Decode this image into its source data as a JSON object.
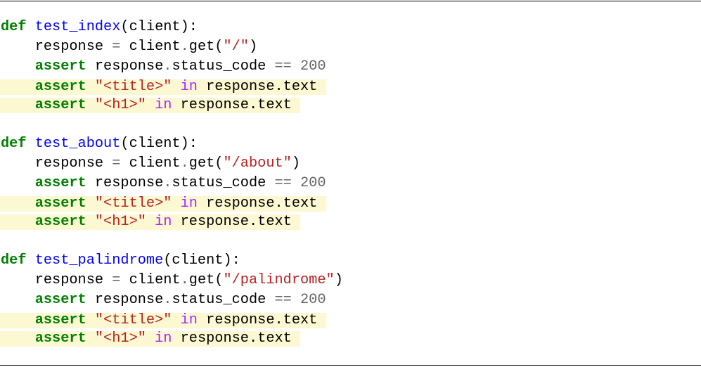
{
  "code_lines": [
    {
      "indent": "",
      "tokens": [
        {
          "t": "def",
          "c": "kw"
        },
        {
          "t": " ",
          "c": "plain"
        },
        {
          "t": "test_index",
          "c": "fn"
        },
        {
          "t": "(client):",
          "c": "plain"
        }
      ]
    },
    {
      "indent": "    ",
      "tokens": [
        {
          "t": "response ",
          "c": "plain"
        },
        {
          "t": "=",
          "c": "op"
        },
        {
          "t": " client",
          "c": "plain"
        },
        {
          "t": ".",
          "c": "op"
        },
        {
          "t": "get(",
          "c": "plain"
        },
        {
          "t": "\"/\"",
          "c": "str"
        },
        {
          "t": ")",
          "c": "plain"
        }
      ]
    },
    {
      "indent": "    ",
      "tokens": [
        {
          "t": "assert",
          "c": "kw"
        },
        {
          "t": " response",
          "c": "plain"
        },
        {
          "t": ".",
          "c": "op"
        },
        {
          "t": "status_code ",
          "c": "plain"
        },
        {
          "t": "==",
          "c": "op"
        },
        {
          "t": " ",
          "c": "plain"
        },
        {
          "t": "200",
          "c": "num"
        }
      ]
    },
    {
      "indent": "    ",
      "highlight": true,
      "tokens": [
        {
          "t": "assert",
          "c": "kw"
        },
        {
          "t": " ",
          "c": "plain"
        },
        {
          "t": "\"<title>\"",
          "c": "str"
        },
        {
          "t": " ",
          "c": "plain"
        },
        {
          "t": "in",
          "c": "opw"
        },
        {
          "t": " response",
          "c": "plain"
        },
        {
          "t": ".",
          "c": "plain"
        },
        {
          "t": "text",
          "c": "plain"
        }
      ]
    },
    {
      "indent": "    ",
      "highlight": true,
      "tokens": [
        {
          "t": "assert",
          "c": "kw"
        },
        {
          "t": " ",
          "c": "plain"
        },
        {
          "t": "\"<h1>\"",
          "c": "str"
        },
        {
          "t": " ",
          "c": "plain"
        },
        {
          "t": "in",
          "c": "opw"
        },
        {
          "t": " response",
          "c": "plain"
        },
        {
          "t": ".",
          "c": "plain"
        },
        {
          "t": "text",
          "c": "plain"
        }
      ]
    },
    {
      "indent": "",
      "tokens": []
    },
    {
      "indent": "",
      "tokens": [
        {
          "t": "def",
          "c": "kw"
        },
        {
          "t": " ",
          "c": "plain"
        },
        {
          "t": "test_about",
          "c": "fn"
        },
        {
          "t": "(client):",
          "c": "plain"
        }
      ]
    },
    {
      "indent": "    ",
      "tokens": [
        {
          "t": "response ",
          "c": "plain"
        },
        {
          "t": "=",
          "c": "op"
        },
        {
          "t": " client",
          "c": "plain"
        },
        {
          "t": ".",
          "c": "op"
        },
        {
          "t": "get(",
          "c": "plain"
        },
        {
          "t": "\"/about\"",
          "c": "str"
        },
        {
          "t": ")",
          "c": "plain"
        }
      ]
    },
    {
      "indent": "    ",
      "tokens": [
        {
          "t": "assert",
          "c": "kw"
        },
        {
          "t": " response",
          "c": "plain"
        },
        {
          "t": ".",
          "c": "op"
        },
        {
          "t": "status_code ",
          "c": "plain"
        },
        {
          "t": "==",
          "c": "op"
        },
        {
          "t": " ",
          "c": "plain"
        },
        {
          "t": "200",
          "c": "num"
        }
      ]
    },
    {
      "indent": "    ",
      "highlight": true,
      "tokens": [
        {
          "t": "assert",
          "c": "kw"
        },
        {
          "t": " ",
          "c": "plain"
        },
        {
          "t": "\"<title>\"",
          "c": "str"
        },
        {
          "t": " ",
          "c": "plain"
        },
        {
          "t": "in",
          "c": "opw"
        },
        {
          "t": " response",
          "c": "plain"
        },
        {
          "t": ".",
          "c": "plain"
        },
        {
          "t": "text",
          "c": "plain"
        }
      ]
    },
    {
      "indent": "    ",
      "highlight": true,
      "tokens": [
        {
          "t": "assert",
          "c": "kw"
        },
        {
          "t": " ",
          "c": "plain"
        },
        {
          "t": "\"<h1>\"",
          "c": "str"
        },
        {
          "t": " ",
          "c": "plain"
        },
        {
          "t": "in",
          "c": "opw"
        },
        {
          "t": " response",
          "c": "plain"
        },
        {
          "t": ".",
          "c": "plain"
        },
        {
          "t": "text",
          "c": "plain"
        }
      ]
    },
    {
      "indent": "",
      "tokens": []
    },
    {
      "indent": "",
      "tokens": [
        {
          "t": "def",
          "c": "kw"
        },
        {
          "t": " ",
          "c": "plain"
        },
        {
          "t": "test_palindrome",
          "c": "fn"
        },
        {
          "t": "(client):",
          "c": "plain"
        }
      ]
    },
    {
      "indent": "    ",
      "tokens": [
        {
          "t": "response ",
          "c": "plain"
        },
        {
          "t": "=",
          "c": "op"
        },
        {
          "t": " client",
          "c": "plain"
        },
        {
          "t": ".",
          "c": "op"
        },
        {
          "t": "get(",
          "c": "plain"
        },
        {
          "t": "\"/palindrome\"",
          "c": "str"
        },
        {
          "t": ")",
          "c": "plain"
        }
      ]
    },
    {
      "indent": "    ",
      "tokens": [
        {
          "t": "assert",
          "c": "kw"
        },
        {
          "t": " response",
          "c": "plain"
        },
        {
          "t": ".",
          "c": "op"
        },
        {
          "t": "status_code ",
          "c": "plain"
        },
        {
          "t": "==",
          "c": "op"
        },
        {
          "t": " ",
          "c": "plain"
        },
        {
          "t": "200",
          "c": "num"
        }
      ]
    },
    {
      "indent": "    ",
      "highlight": true,
      "tokens": [
        {
          "t": "assert",
          "c": "kw"
        },
        {
          "t": " ",
          "c": "plain"
        },
        {
          "t": "\"<title>\"",
          "c": "str"
        },
        {
          "t": " ",
          "c": "plain"
        },
        {
          "t": "in",
          "c": "opw"
        },
        {
          "t": " response",
          "c": "plain"
        },
        {
          "t": ".",
          "c": "plain"
        },
        {
          "t": "text",
          "c": "plain"
        }
      ]
    },
    {
      "indent": "    ",
      "highlight": true,
      "tokens": [
        {
          "t": "assert",
          "c": "kw"
        },
        {
          "t": " ",
          "c": "plain"
        },
        {
          "t": "\"<h1>\"",
          "c": "str"
        },
        {
          "t": " ",
          "c": "plain"
        },
        {
          "t": "in",
          "c": "opw"
        },
        {
          "t": " response",
          "c": "plain"
        },
        {
          "t": ".",
          "c": "plain"
        },
        {
          "t": "text",
          "c": "plain"
        }
      ]
    }
  ],
  "colors": {
    "keyword": "#008000",
    "function": "#0000ff",
    "string": "#ba2121",
    "number": "#666666",
    "operator": "#666666",
    "operator_word": "#aa22ff",
    "highlight_bg": "#fbf8d2"
  }
}
